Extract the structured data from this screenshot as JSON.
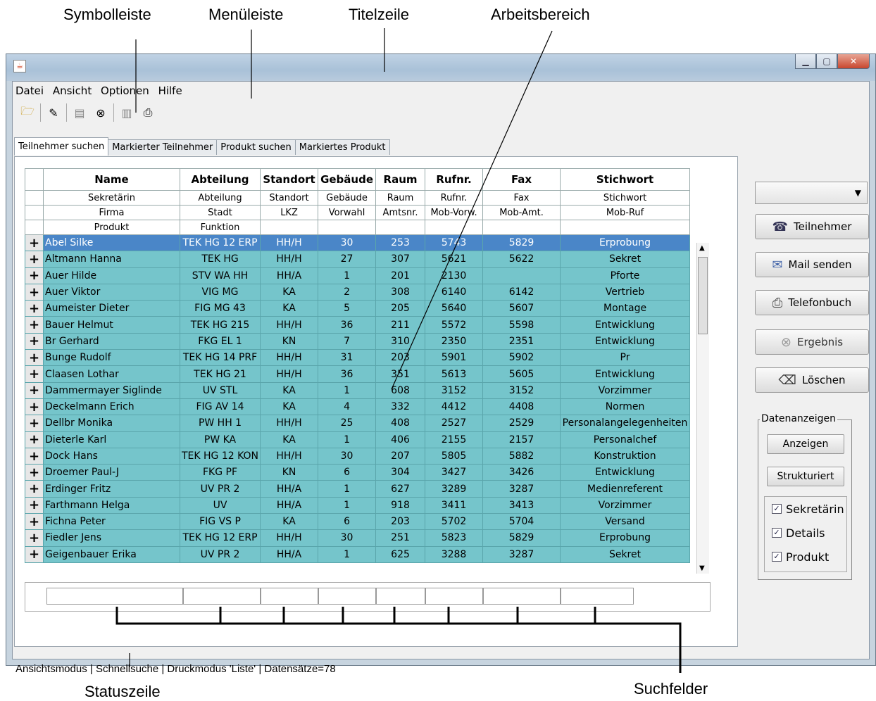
{
  "callouts": {
    "symbolleiste": "Symbolleiste",
    "menueleiste": "Menüleiste",
    "titelzeile": "Titelzeile",
    "arbeitsbereich": "Arbeitsbereich",
    "statuszeile": "Statuszeile",
    "suchfelder": "Suchfelder"
  },
  "menu": {
    "datei": "Datei",
    "ansicht": "Ansicht",
    "optionen": "Optionen",
    "hilfe": "Hilfe"
  },
  "toolbar_icons": [
    "open-folder-icon",
    "edit-icon",
    "book-icon",
    "binoculars-icon",
    "book2-icon",
    "print-icon"
  ],
  "tabs": [
    "Teilnehmer suchen",
    "Markierter Teilnehmer",
    "Produkt suchen",
    "Markiertes Produkt"
  ],
  "table": {
    "headers": [
      "Name",
      "Abteilung",
      "Standort",
      "Gebäude",
      "Raum",
      "Rufnr.",
      "Fax",
      "Stichwort"
    ],
    "sub1": [
      "Sekretärin",
      "Abteilung",
      "Standort",
      "Gebäude",
      "Raum",
      "Rufnr.",
      "Fax",
      "Stichwort"
    ],
    "sub2": [
      "Firma",
      "Stadt",
      "LKZ",
      "Vorwahl",
      "Amtsnr.",
      "Mob-Vorw.",
      "Mob-Amt.",
      "Mob-Ruf"
    ],
    "sub3": [
      "Produkt",
      "Funktion",
      "",
      "",
      "",
      "",
      "",
      ""
    ],
    "rows": [
      [
        "Abel Silke",
        "TEK HG 12 ERP",
        "HH/H",
        "30",
        "253",
        "5743",
        "5829",
        "Erprobung"
      ],
      [
        "Altmann Hanna",
        "TEK HG",
        "HH/H",
        "27",
        "307",
        "5621",
        "5622",
        "Sekret"
      ],
      [
        "Auer Hilde",
        "STV WA HH",
        "HH/A",
        "1",
        "201",
        "2130",
        "",
        "Pforte"
      ],
      [
        "Auer Viktor",
        "VIG MG",
        "KA",
        "2",
        "308",
        "6140",
        "6142",
        "Vertrieb"
      ],
      [
        "Aumeister Dieter",
        "FIG MG 43",
        "KA",
        "5",
        "205",
        "5640",
        "5607",
        "Montage"
      ],
      [
        "Bauer Helmut",
        "TEK HG 215",
        "HH/H",
        "36",
        "211",
        "5572",
        "5598",
        "Entwicklung"
      ],
      [
        "Br Gerhard",
        "FKG EL 1",
        "KN",
        "7",
        "310",
        "2350",
        "2351",
        "Entwicklung"
      ],
      [
        "Bunge Rudolf",
        "TEK HG 14 PRF",
        "HH/H",
        "31",
        "203",
        "5901",
        "5902",
        "Pr"
      ],
      [
        "Claasen Lothar",
        "TEK HG 21",
        "HH/H",
        "36",
        "351",
        "5613",
        "5605",
        "Entwicklung"
      ],
      [
        "Dammermayer Siglinde",
        "UV STL",
        "KA",
        "1",
        "608",
        "3152",
        "3152",
        "Vorzimmer"
      ],
      [
        "Deckelmann Erich",
        "FIG AV 14",
        "KA",
        "4",
        "332",
        "4412",
        "4408",
        "Normen"
      ],
      [
        "Dellbr Monika",
        "PW HH 1",
        "HH/H",
        "25",
        "408",
        "2527",
        "2529",
        "Personalangelegenheiten"
      ],
      [
        "Dieterle Karl",
        "PW KA",
        "KA",
        "1",
        "406",
        "2155",
        "2157",
        "Personalchef"
      ],
      [
        "Dock Hans",
        "TEK HG 12 KON",
        "HH/H",
        "30",
        "207",
        "5805",
        "5882",
        "Konstruktion"
      ],
      [
        "Droemer Paul-J",
        "FKG PF",
        "KN",
        "6",
        "304",
        "3427",
        "3426",
        "Entwicklung"
      ],
      [
        "Erdinger Fritz",
        "UV PR 2",
        "HH/A",
        "1",
        "627",
        "3289",
        "3287",
        "Medienreferent"
      ],
      [
        "Farthmann Helga",
        "UV",
        "HH/A",
        "1",
        "918",
        "3411",
        "3413",
        "Vorzimmer"
      ],
      [
        "Fichna Peter",
        "FIG VS P",
        "KA",
        "6",
        "203",
        "5702",
        "5704",
        "Versand"
      ],
      [
        "Fiedler Jens",
        "TEK HG 12 ERP",
        "HH/H",
        "30",
        "251",
        "5823",
        "5829",
        "Erprobung"
      ],
      [
        "Geigenbauer Erika",
        "UV PR 2",
        "HH/A",
        "1",
        "625",
        "3288",
        "3287",
        "Sekret"
      ]
    ]
  },
  "side_buttons": [
    "Teilnehmer",
    "Mail senden",
    "Telefonbuch",
    "Ergebnis",
    "Löschen"
  ],
  "group": {
    "title": "Datenanzeigen",
    "anzeigen": "Anzeigen",
    "strukturiert": "Strukturiert",
    "checks": [
      "Sekretärin",
      "Details",
      "Produkt"
    ]
  },
  "status": "Ansichtsmodus | Schnellsuche | Druckmodus 'Liste' | Datensätze=78",
  "colors": {
    "row": "#75c5cb",
    "selected_row": "#4a86c8"
  }
}
